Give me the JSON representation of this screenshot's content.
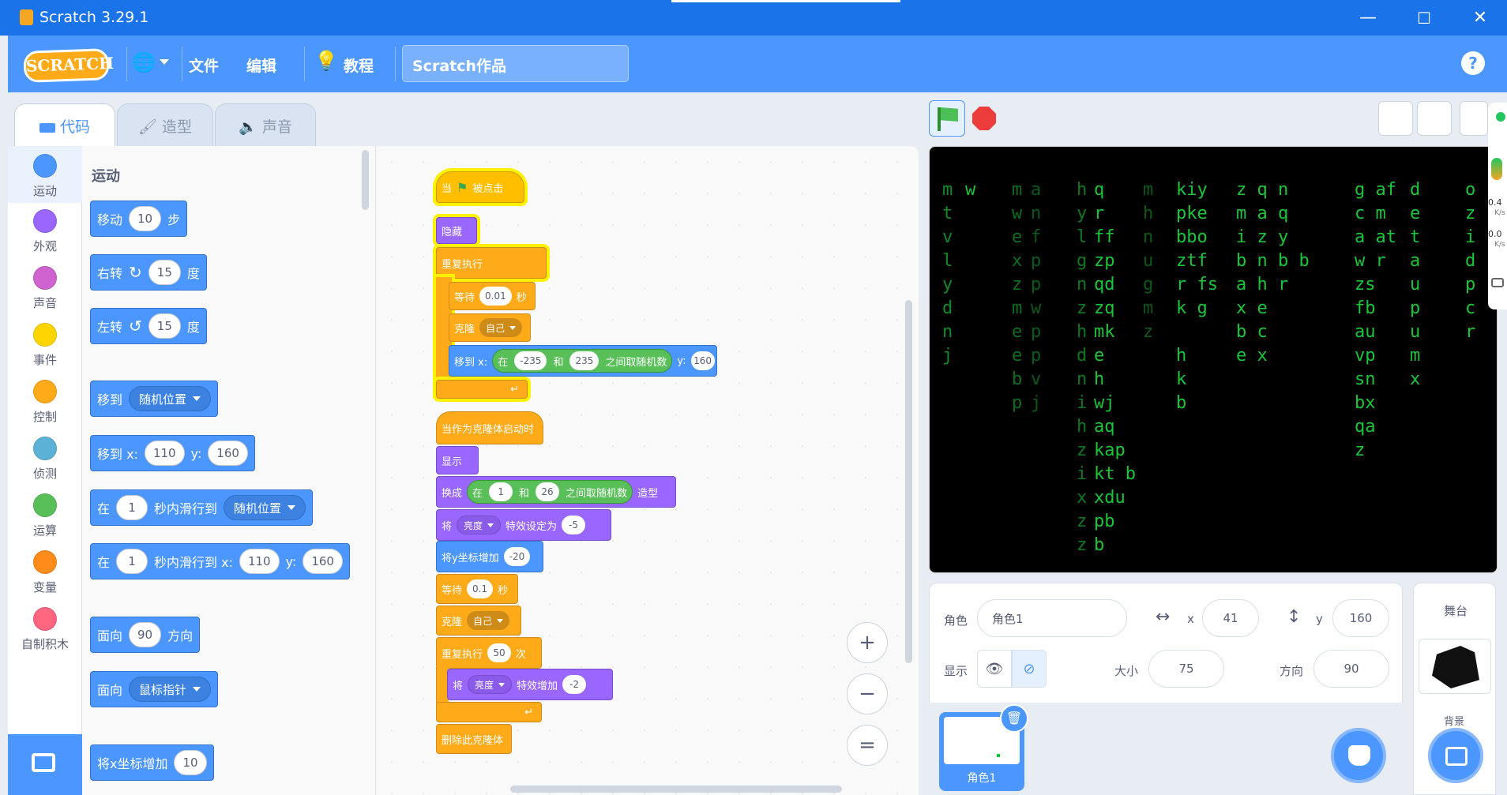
{
  "window": {
    "title": "Scratch 3.29.1",
    "minimize": "—",
    "maximize": "☐",
    "close": "✕"
  },
  "menu": {
    "logo": "SCRATCH",
    "globe": "🌐",
    "file": "文件",
    "edit": "编辑",
    "tutorials": "教程",
    "project_name": "Scratch作品",
    "help": "?"
  },
  "tabs": {
    "code": "代码",
    "costumes": "造型",
    "sounds": "声音"
  },
  "categories": [
    {
      "label": "运动",
      "color": "#4c97ff"
    },
    {
      "label": "外观",
      "color": "#9966ff"
    },
    {
      "label": "声音",
      "color": "#cf63cf"
    },
    {
      "label": "事件",
      "color": "#ffd500"
    },
    {
      "label": "控制",
      "color": "#ffab19"
    },
    {
      "label": "侦测",
      "color": "#5cb1d6"
    },
    {
      "label": "运算",
      "color": "#59c059"
    },
    {
      "label": "变量",
      "color": "#ff8c1a"
    },
    {
      "label": "自制积木",
      "color": "#ff6680"
    }
  ],
  "palette": {
    "title": "运动",
    "move": {
      "a": "移动",
      "v": "10",
      "b": "步"
    },
    "turn_right": {
      "a": "右转",
      "icon": "↻",
      "v": "15",
      "b": "度"
    },
    "turn_left": {
      "a": "左转",
      "icon": "↺",
      "v": "15",
      "b": "度"
    },
    "goto": {
      "a": "移到",
      "dd": "随机位置"
    },
    "goto_xy": {
      "a": "移到 x:",
      "x": "110",
      "y_label": "y:",
      "y": "160"
    },
    "glide": {
      "a": "在",
      "v": "1",
      "b": "秒内滑行到",
      "dd": "随机位置"
    },
    "glide_xy": {
      "a": "在",
      "v": "1",
      "b": "秒内滑行到 x:",
      "x": "110",
      "y_label": "y:",
      "y": "160"
    },
    "point": {
      "a": "面向",
      "v": "90",
      "b": "方向"
    },
    "point_towards": {
      "a": "面向",
      "dd": "鼠标指针"
    },
    "change_x": {
      "a": "将x坐标增加",
      "v": "10"
    }
  },
  "script1": {
    "when_flag": "当",
    "flag_clicked": "被点击",
    "hide": "隐藏",
    "forever": "重复执行",
    "wait": "等待",
    "wait_v": "0.01",
    "sec": "秒",
    "clone": "克隆",
    "clone_dd": "自己",
    "goto_x": "移到 x:",
    "in": "在",
    "min": "-235",
    "and": "和",
    "max": "235",
    "rand": "之间取随机数",
    "y_label": "y:",
    "y": "160",
    "loop_arrow": "↵"
  },
  "script2": {
    "hat": "当作为克隆体启动时",
    "show": "显示",
    "switch": "换成",
    "in": "在",
    "min": "1",
    "and": "和",
    "max": "26",
    "rand": "之间取随机数",
    "costume": "造型",
    "set": "将",
    "effect_dd": "亮度",
    "set_to": "特效设定为",
    "set_v": "-5",
    "change_y": "将y坐标增加",
    "change_y_v": "-20",
    "wait": "等待",
    "wait_v": "0.1",
    "sec": "秒",
    "clone": "克隆",
    "clone_dd": "自己",
    "repeat": "重复执行",
    "repeat_v": "50",
    "times": "次",
    "change": "将",
    "change_dd": "亮度",
    "change_by": "特效增加",
    "change_v": "-2",
    "delete": "删除此克隆体"
  },
  "zoom": {
    "in": "+",
    "out": "−",
    "reset": "="
  },
  "stage_matrix": [
    "m\nt\nv\nl\ny\nd\nn\nj",
    "w",
    "m\nw\ne\nx\nz\nm\ne\ne\nb\np",
    "a\nn\nf\np\np\nw\np\np\nv\nj",
    "h\ny\nl\ng\nn\nz\nh\nd\nn\ni\nh\nz\ni\nx\nz\nz",
    "q\nr\nff\nzp\nqd\nzq\nmk\ne\nh\nwj\naq\nkap\nkt b\nxdu\npb\nb",
    "m\nh\nn\nu\ng\nm\nz",
    "kiy\npke\nbbo\nztf\nr fs\nk g\n\nh\nk\nb",
    "z q n\nm a q\ni z y\nb n b b\na h r\nx e\nb c\ne x",
    "g af\nc m\na at\nw r\nzs\nfb\nau\nvp\nsn\nbx\nqa\nz",
    "d\ne\nt\na\nu\np\nu\nm\nx",
    "o\nz\ni\nd\np\nc\nr"
  ],
  "sprite_info": {
    "sprite_label": "角色",
    "name": "角色1",
    "x_label": "x",
    "x": "41",
    "y_label": "y",
    "y": "160",
    "show_label": "显示",
    "size_label": "大小",
    "size": "75",
    "dir_label": "方向",
    "dir": "90"
  },
  "sprite_list": {
    "name": "角色1"
  },
  "stage_panel": {
    "title": "舞台",
    "backdrops": "背景"
  },
  "net": {
    "up": "0.4",
    "up_unit": "K/s",
    "down": "0.0",
    "down_unit": "K/s"
  }
}
